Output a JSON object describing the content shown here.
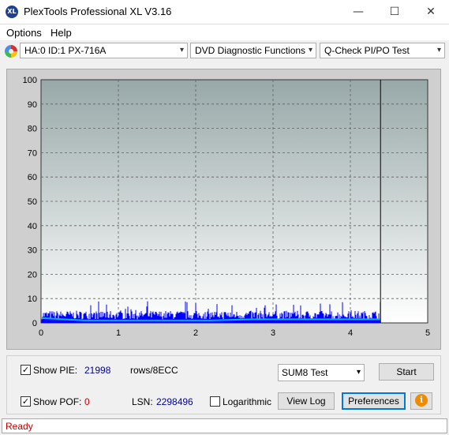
{
  "window": {
    "title": "PlexTools Professional XL V3.16",
    "icon_text": "XL",
    "minimize": "—",
    "maximize": "☐",
    "close": "✕"
  },
  "menu": {
    "options": "Options",
    "help": "Help"
  },
  "toolbar": {
    "drive": "HA:0 ID:1  PX-716A",
    "function": "DVD Diagnostic Functions",
    "test": "Q-Check PI/PO Test",
    "drive_icon": "disc-icon"
  },
  "chart_data": {
    "type": "bar",
    "title": "",
    "xlabel": "",
    "ylabel": "",
    "xlim": [
      0,
      5
    ],
    "ylim": [
      0,
      100
    ],
    "x_ticks": [
      "0",
      "1",
      "2",
      "3",
      "4",
      "5"
    ],
    "y_ticks": [
      "0",
      "10",
      "20",
      "30",
      "40",
      "50",
      "60",
      "70",
      "80",
      "90",
      "100"
    ],
    "grid": true,
    "data_end_x": 4.39,
    "series": [
      {
        "color": "#0000ff",
        "typical_peak": 5,
        "max_peak": 9
      },
      {
        "color": "#00b4f0",
        "values_approx": [
          2,
          1,
          1,
          1,
          1,
          1.5,
          1.5,
          1.5,
          1.5
        ]
      }
    ],
    "colors": {
      "background_top": "#98a8a8",
      "background_bottom": "#ffffff",
      "grid": "#606060"
    }
  },
  "controls": {
    "show_pie_label": "Show PIE:",
    "show_pie_checked": "✓",
    "pie_value": "21998",
    "pie_unit": "rows/8ECC",
    "show_pof_label": "Show POF:",
    "show_pof_checked": "✓",
    "pof_value": "0",
    "lsn_label": "LSN:",
    "lsn_value": "2298496",
    "logarithmic_label": "Logarithmic",
    "sum_select": "SUM8 Test",
    "start": "Start",
    "view_log": "View Log",
    "preferences": "Preferences",
    "info_icon": "info-icon",
    "info_glyph": "i"
  },
  "status": {
    "text": "Ready"
  }
}
